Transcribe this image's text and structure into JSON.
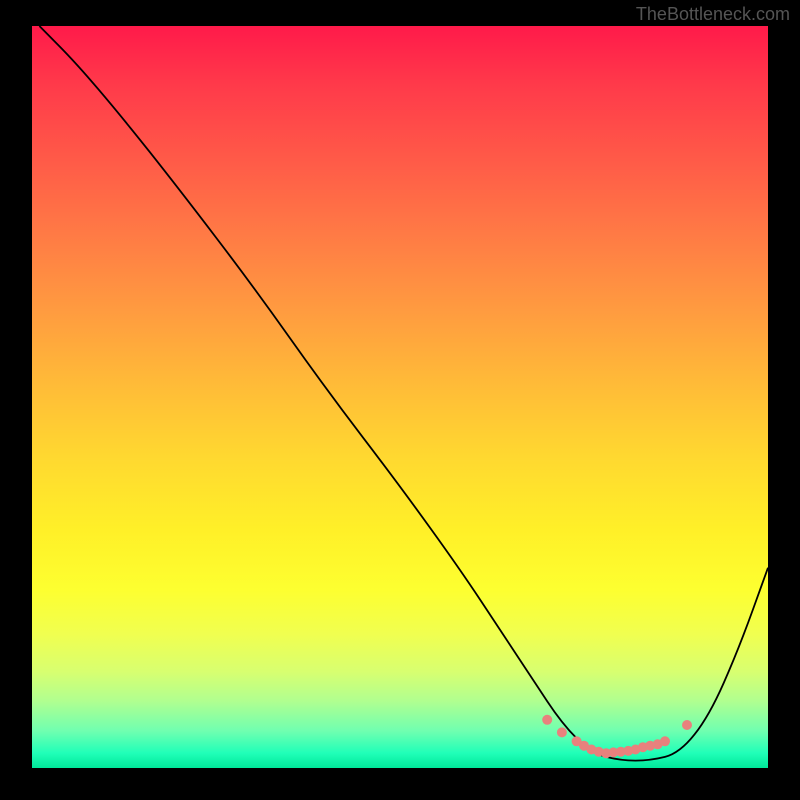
{
  "watermark": "TheBottleneck.com",
  "chart_data": {
    "type": "line",
    "title": "",
    "xlabel": "",
    "ylabel": "",
    "xlim": [
      0,
      100
    ],
    "ylim": [
      0,
      100
    ],
    "grid": false,
    "legend": false,
    "series": [
      {
        "name": "curve",
        "x": [
          1,
          6,
          12,
          20,
          30,
          40,
          50,
          58,
          64,
          68,
          72,
          76,
          80,
          84,
          88,
          92,
          96,
          100
        ],
        "y": [
          100,
          95,
          88,
          78,
          65,
          51,
          38,
          27,
          18,
          12,
          6,
          2,
          1,
          1,
          2,
          7,
          16,
          27
        ]
      }
    ],
    "markers": {
      "name": "highlight-points",
      "x": [
        70,
        72,
        74,
        75,
        76,
        77,
        78,
        79,
        80,
        81,
        82,
        83,
        84,
        85,
        86,
        89
      ],
      "y": [
        6.5,
        4.8,
        3.6,
        3.0,
        2.5,
        2.2,
        2.0,
        2.1,
        2.2,
        2.3,
        2.5,
        2.8,
        3.0,
        3.2,
        3.6,
        5.8
      ]
    },
    "background": "red-yellow-green vertical gradient"
  }
}
